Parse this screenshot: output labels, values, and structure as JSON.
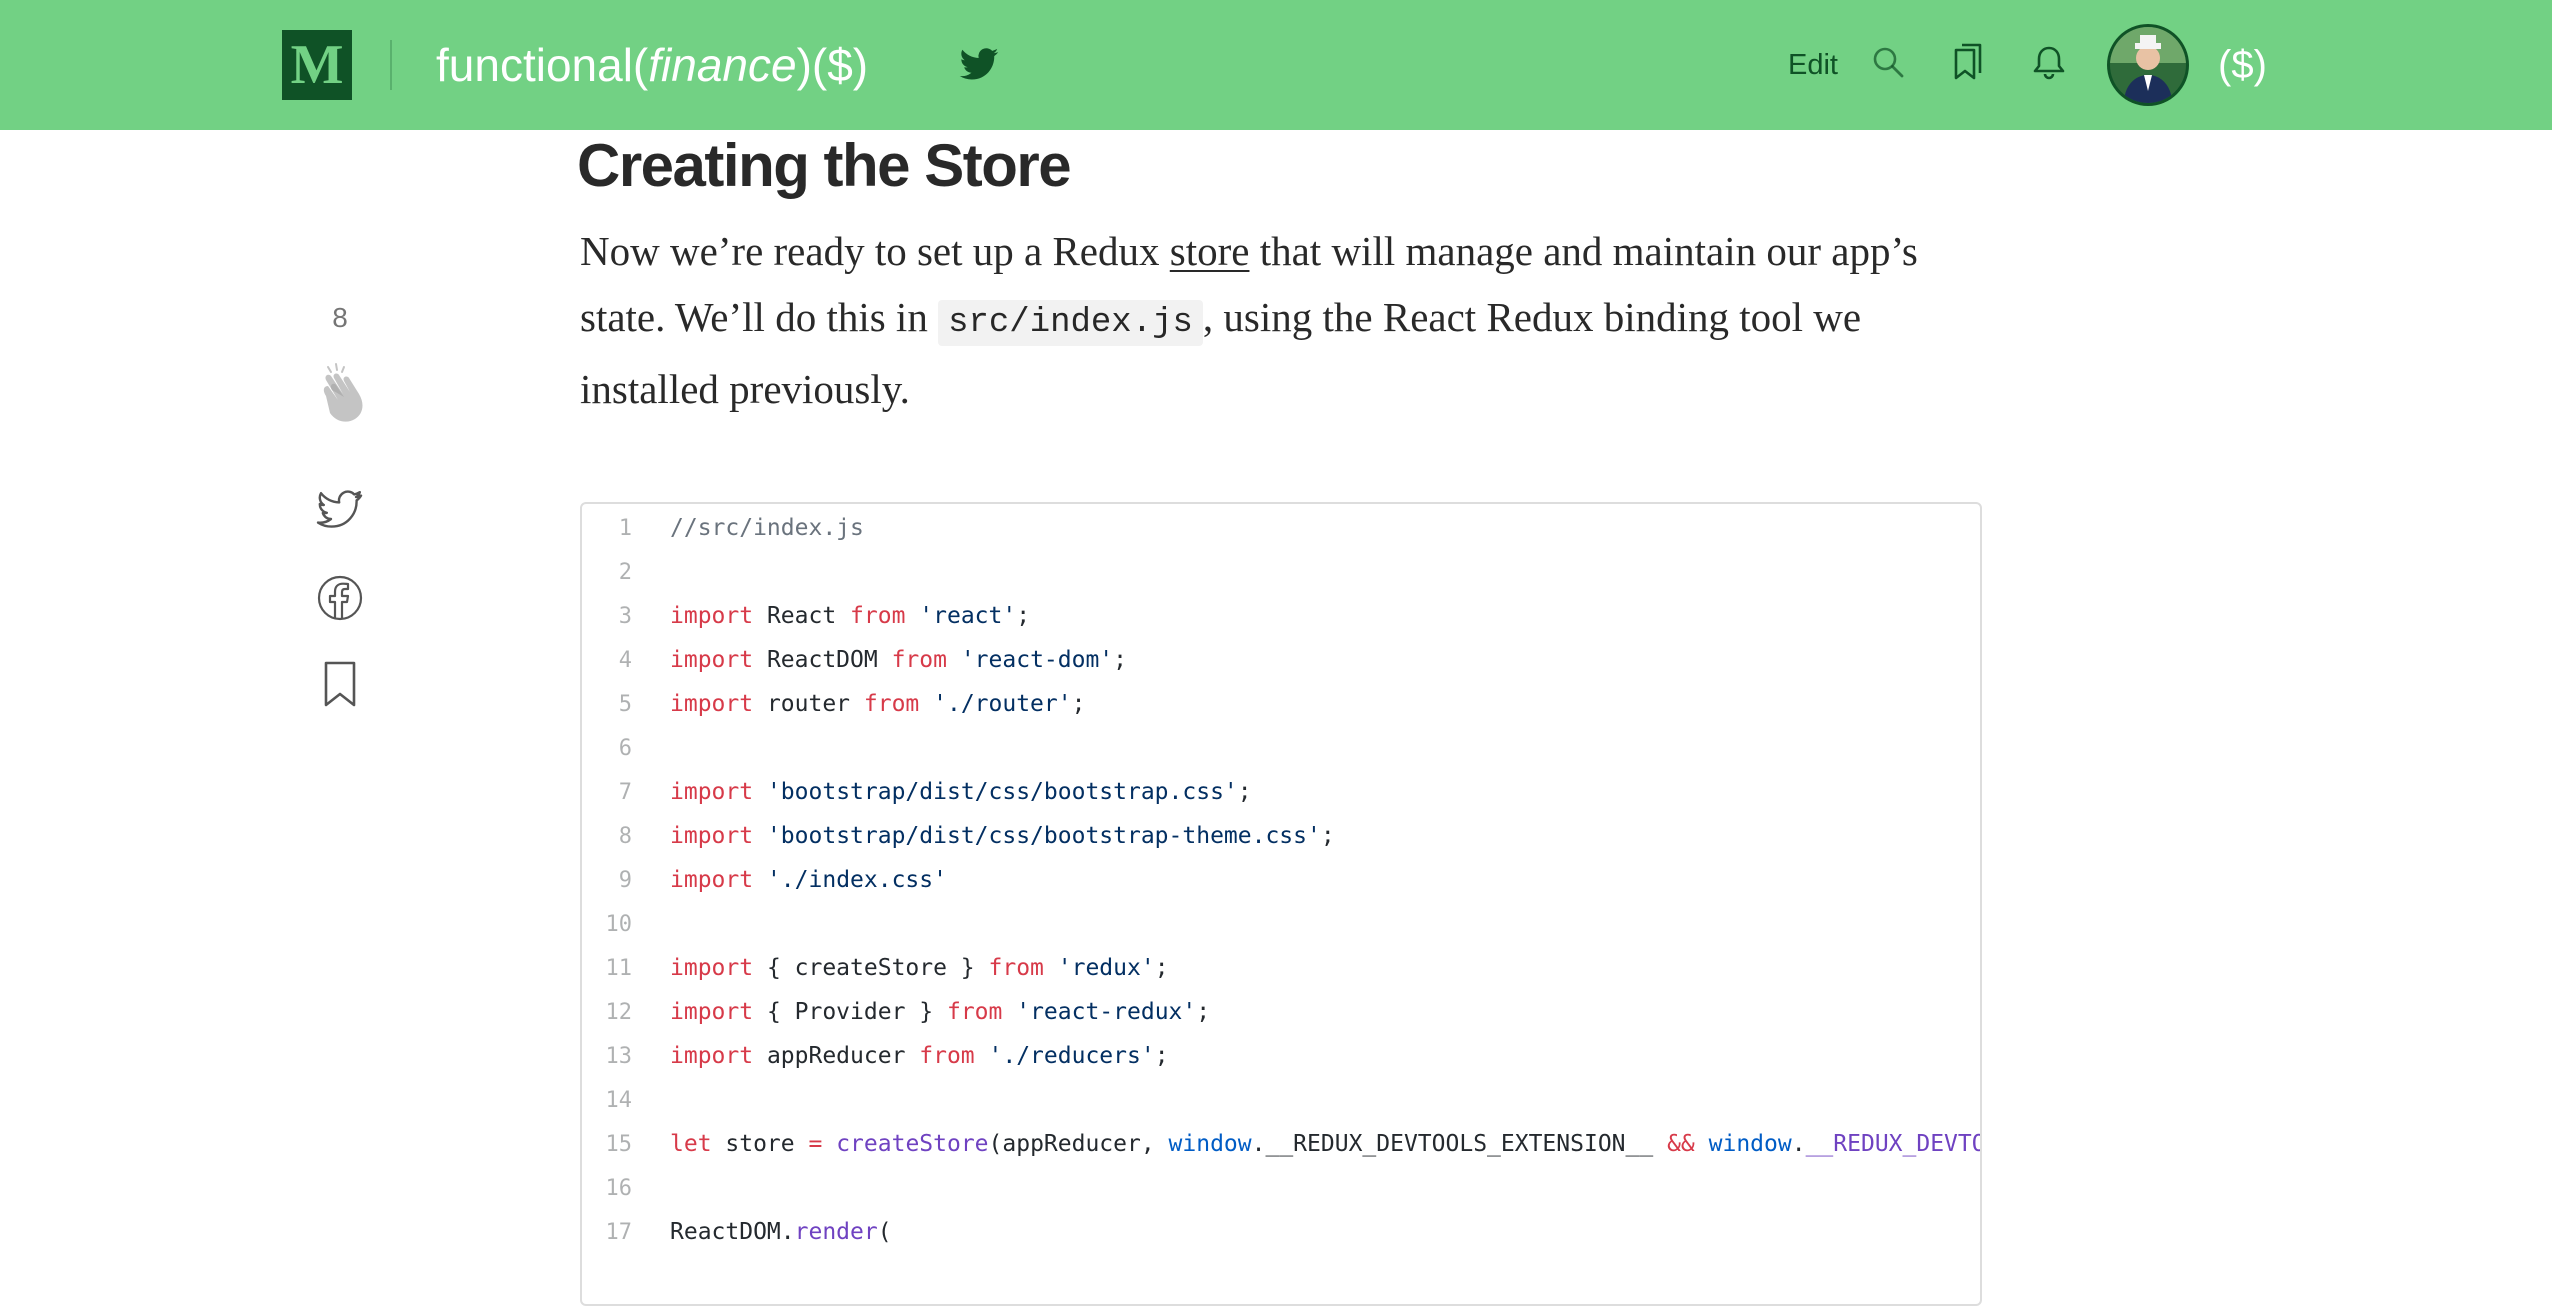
{
  "header": {
    "logo_letter": "M",
    "publication": {
      "prefix": "functional(",
      "italic": "finance",
      "suffix": ")($)"
    },
    "edit_label": "Edit",
    "currency_label": "($)",
    "background_color": "#72d184",
    "logo_background": "#0f5226",
    "icons": [
      "twitter-icon",
      "search-icon",
      "bookmarks-icon",
      "bell-icon",
      "avatar"
    ]
  },
  "share_rail": {
    "clap_count": "8",
    "icons": [
      "clap-icon",
      "twitter-icon",
      "facebook-icon",
      "bookmark-icon"
    ]
  },
  "article": {
    "heading": "Creating the Store",
    "paragraph": {
      "part1": "Now we’re ready to set up a Redux ",
      "link": "store",
      "part2": " that will manage and maintain our app’s state. We’ll do this in ",
      "code": "src/index.js",
      "part3": ", using the React Redux binding tool we installed previously."
    }
  },
  "code_block": {
    "lines": [
      {
        "n": "1",
        "tokens": [
          [
            "cmt",
            "//src/index.js"
          ]
        ]
      },
      {
        "n": "2",
        "tokens": []
      },
      {
        "n": "3",
        "tokens": [
          [
            "kw",
            "import"
          ],
          [
            "pl",
            " React "
          ],
          [
            "kw",
            "from"
          ],
          [
            "pl",
            " "
          ],
          [
            "str",
            "'react'"
          ],
          [
            "pl",
            ";"
          ]
        ]
      },
      {
        "n": "4",
        "tokens": [
          [
            "kw",
            "import"
          ],
          [
            "pl",
            " ReactDOM "
          ],
          [
            "kw",
            "from"
          ],
          [
            "pl",
            " "
          ],
          [
            "str",
            "'react-dom'"
          ],
          [
            "pl",
            ";"
          ]
        ]
      },
      {
        "n": "5",
        "tokens": [
          [
            "kw",
            "import"
          ],
          [
            "pl",
            " router "
          ],
          [
            "kw",
            "from"
          ],
          [
            "pl",
            " "
          ],
          [
            "str",
            "'./router'"
          ],
          [
            "pl",
            ";"
          ]
        ]
      },
      {
        "n": "6",
        "tokens": []
      },
      {
        "n": "7",
        "tokens": [
          [
            "kw",
            "import"
          ],
          [
            "pl",
            " "
          ],
          [
            "str",
            "'bootstrap/dist/css/bootstrap.css'"
          ],
          [
            "pl",
            ";"
          ]
        ]
      },
      {
        "n": "8",
        "tokens": [
          [
            "kw",
            "import"
          ],
          [
            "pl",
            " "
          ],
          [
            "str",
            "'bootstrap/dist/css/bootstrap-theme.css'"
          ],
          [
            "pl",
            ";"
          ]
        ]
      },
      {
        "n": "9",
        "tokens": [
          [
            "kw",
            "import"
          ],
          [
            "pl",
            " "
          ],
          [
            "str",
            "'./index.css'"
          ]
        ]
      },
      {
        "n": "10",
        "tokens": []
      },
      {
        "n": "11",
        "tokens": [
          [
            "kw",
            "import"
          ],
          [
            "pl",
            " { createStore } "
          ],
          [
            "kw",
            "from"
          ],
          [
            "pl",
            " "
          ],
          [
            "str",
            "'redux'"
          ],
          [
            "pl",
            ";"
          ]
        ]
      },
      {
        "n": "12",
        "tokens": [
          [
            "kw",
            "import"
          ],
          [
            "pl",
            " { Provider } "
          ],
          [
            "kw",
            "from"
          ],
          [
            "pl",
            " "
          ],
          [
            "str",
            "'react-redux'"
          ],
          [
            "pl",
            ";"
          ]
        ]
      },
      {
        "n": "13",
        "tokens": [
          [
            "kw",
            "import"
          ],
          [
            "pl",
            " appReducer "
          ],
          [
            "kw",
            "from"
          ],
          [
            "pl",
            " "
          ],
          [
            "str",
            "'./reducers'"
          ],
          [
            "pl",
            ";"
          ]
        ]
      },
      {
        "n": "14",
        "tokens": []
      },
      {
        "n": "15",
        "tokens": [
          [
            "kw",
            "let"
          ],
          [
            "pl",
            " store "
          ],
          [
            "kw",
            "="
          ],
          [
            "pl",
            " "
          ],
          [
            "fn",
            "createStore"
          ],
          [
            "pl",
            "(appReducer, "
          ],
          [
            "var",
            "window"
          ],
          [
            "pl",
            ".__REDUX_DEVTOOLS_EXTENSION__ "
          ],
          [
            "kw",
            "&&"
          ],
          [
            "pl",
            " "
          ],
          [
            "var",
            "window"
          ],
          [
            "pl",
            "."
          ],
          [
            "fn",
            "__REDUX_DEVTOOLS_"
          ]
        ]
      },
      {
        "n": "16",
        "tokens": []
      },
      {
        "n": "17",
        "tokens": [
          [
            "pl",
            "ReactDOM."
          ],
          [
            "fn",
            "render"
          ],
          [
            "pl",
            "("
          ]
        ]
      }
    ]
  }
}
